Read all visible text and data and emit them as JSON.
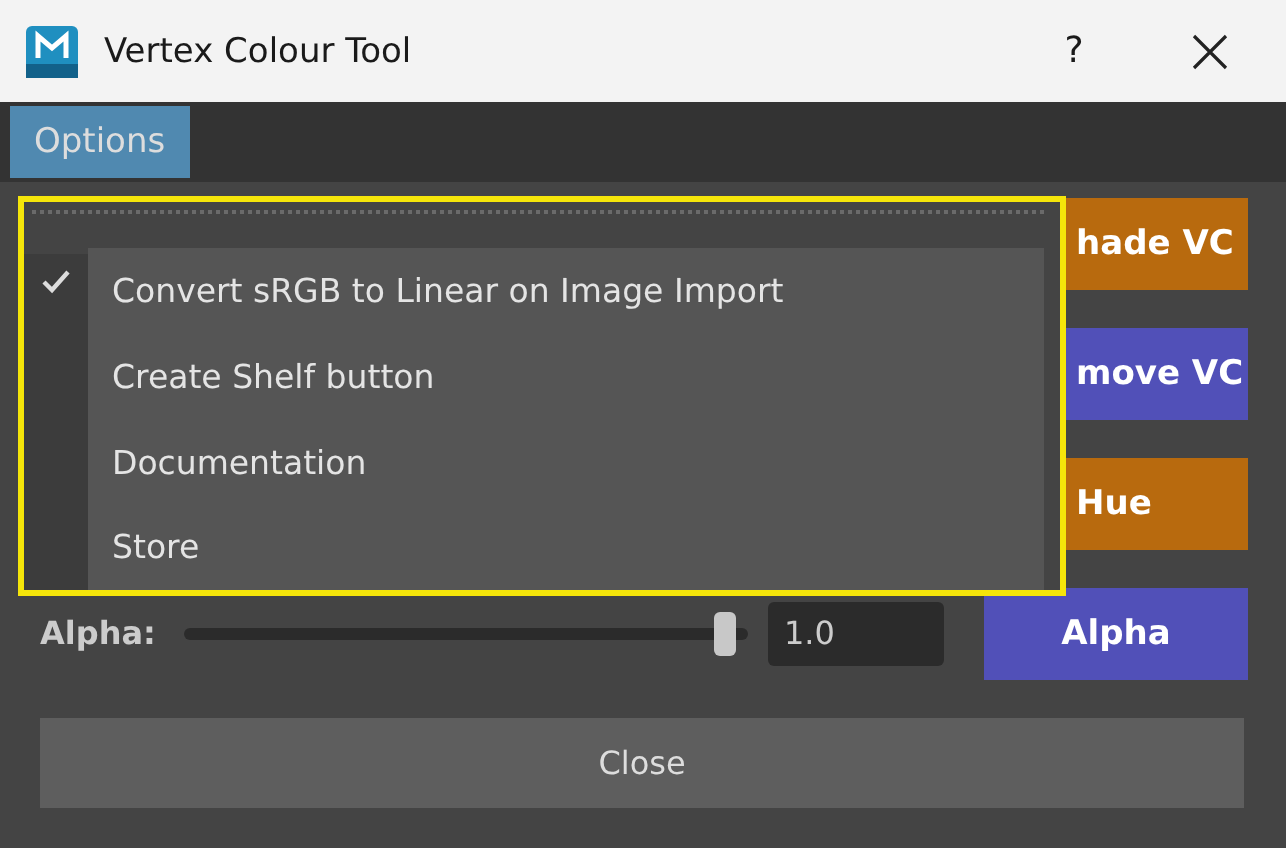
{
  "window": {
    "title": "Vertex Colour Tool",
    "help": "?"
  },
  "menubar": [
    {
      "label": "Options",
      "selected": true
    }
  ],
  "menu": {
    "items": [
      {
        "label": "Convert sRGB to Linear on Image Import",
        "checked": true
      },
      {
        "label": "Create Shelf button",
        "checked": false
      },
      {
        "label": "Documentation",
        "checked": false
      },
      {
        "label": "Store",
        "checked": false
      }
    ]
  },
  "buttons": [
    {
      "label": "hade VC",
      "color": "#b86a0e",
      "covered": true
    },
    {
      "label": "move VC",
      "color": "#5150b8",
      "covered": true
    },
    {
      "label": "Hue",
      "color": "#b86a0e",
      "covered": true
    },
    {
      "label": "Alpha",
      "color": "#5150b8",
      "covered": false
    }
  ],
  "alpha": {
    "label": "Alpha:",
    "level": 1.0,
    "value": "1.0"
  },
  "close": "Close"
}
